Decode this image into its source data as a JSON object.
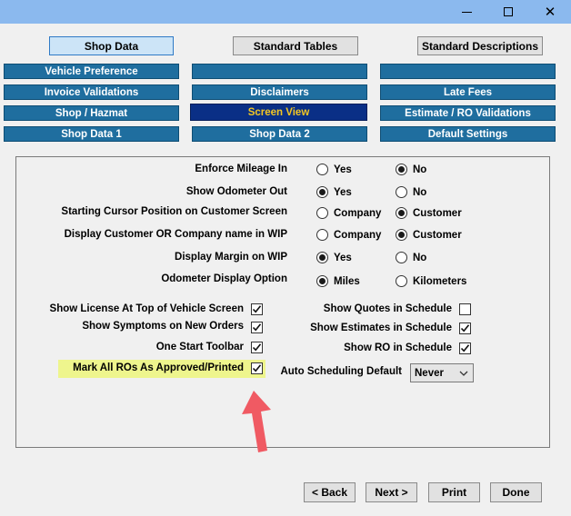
{
  "window": {
    "minimize_label": "minimize",
    "maximize_label": "maximize",
    "close_label": "close"
  },
  "top_tabs": [
    "Shop Data",
    "Standard Tables",
    "Standard Descriptions"
  ],
  "tabs": {
    "vehicle_preference": "Vehicle Preference",
    "blank_1": "",
    "blank_2": "",
    "invoice_validations": "Invoice Validations",
    "disclaimers": "Disclaimers",
    "late_fees": "Late Fees",
    "shop_hazmat": "Shop / Hazmat",
    "screen_view": "Screen View",
    "estimate_ro_validations": "Estimate / RO Validations",
    "shop_data_1": "Shop Data 1",
    "shop_data_2": "Shop Data 2",
    "default_settings": "Default Settings"
  },
  "settings": {
    "enforce_mileage": {
      "label": "Enforce Mileage In",
      "opt1": "Yes",
      "opt2": "No",
      "selected": "No"
    },
    "show_odometer": {
      "label": "Show Odometer Out",
      "opt1": "Yes",
      "opt2": "No",
      "selected": "Yes"
    },
    "cursor_position": {
      "label": "Starting Cursor Position on Customer Screen",
      "opt1": "Company",
      "opt2": "Customer",
      "selected": "Customer"
    },
    "display_name": {
      "label": "Display Customer OR Company name in WIP",
      "opt1": "Company",
      "opt2": "Customer",
      "selected": "Customer"
    },
    "display_margin": {
      "label": "Display Margin on WIP",
      "opt1": "Yes",
      "opt2": "No",
      "selected": "Yes"
    },
    "odometer_option": {
      "label": "Odometer Display Option",
      "opt1": "Miles",
      "opt2": "Kilometers",
      "selected": "Miles"
    }
  },
  "checkboxes": {
    "license_top": {
      "label": "Show License At Top of Vehicle Screen",
      "checked": true
    },
    "symptoms": {
      "label": "Show Symptoms on New Orders",
      "checked": true
    },
    "one_start": {
      "label": "One Start Toolbar",
      "checked": true
    },
    "mark_approved": {
      "label": "Mark All ROs As Approved/Printed",
      "checked": true
    },
    "quotes_schedule": {
      "label": "Show Quotes in Schedule",
      "checked": false
    },
    "estimates_schedule": {
      "label": "Show Estimates in Schedule",
      "checked": true
    },
    "ro_schedule": {
      "label": "Show RO in Schedule",
      "checked": true
    }
  },
  "auto_scheduling": {
    "label": "Auto Scheduling Default",
    "value": "Never"
  },
  "nav": {
    "back": "< Back",
    "next": "Next >",
    "print": "Print",
    "done": "Done"
  },
  "colors": {
    "tab": "#1f6e9f",
    "tab_selected": "#0a2f86",
    "highlight": "#eef58d",
    "arrow": "#f05a63"
  }
}
